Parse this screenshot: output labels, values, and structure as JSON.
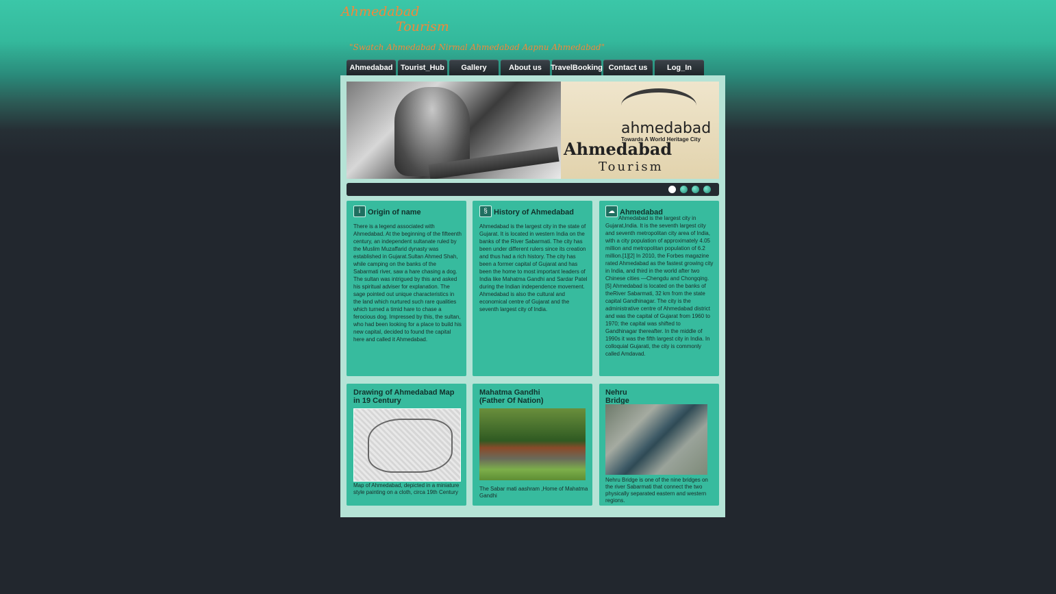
{
  "header": {
    "logo_line1": "Ahmedabad",
    "logo_line2": "Tourism",
    "tagline": "\"Swatch Ahmedabad Nirmal Ahmedabad Aapnu Ahmedabad\""
  },
  "nav": {
    "items": [
      "Ahmedabad",
      "Tourist_Hub",
      "Gallery",
      "About us",
      "TravelBooking",
      "Contact us",
      "Log_In"
    ]
  },
  "banner": {
    "poster_title": "ahmedabad",
    "poster_subtitle": "Towards A World Heritage City",
    "poster_big": "Ahmedabad",
    "poster_tourism": "Tourism"
  },
  "slider": {
    "slide_count": 4,
    "active_index": 0
  },
  "cards_top": [
    {
      "title": "Origin of name",
      "icon": "info-icon",
      "text": "There is a legend associated with Ahmedabad. At the beginning of the fifteenth century, an independent sultanate ruled by the Muslim Muzaffarid dynasty was established in Gujarat.Sultan Ahmed Shah, while camping on the banks of the Sabarmati river, saw a hare chasing a dog. The sultan was intrigued by this and asked his spiritual adviser for explanation. The sage pointed out unique characteristics in the land which nurtured such rare qualities which turned a timid hare to chase a ferocious dog. Impressed by this, the sultan, who had been looking for a place to build his new capital, decided to found the capital here and called it Ahmedabad."
    },
    {
      "title": "History of Ahmedabad",
      "icon": "scroll-icon",
      "text": "Ahmedabad is the largest city in the state of Gujarat. It is located in western India on the banks of the River Sabarmati. The city has been under different rulers since its creation and thus had a rich history. The city has been a former capital of Gujarat and has been the home to most important leaders of India like Mahatma Gandhi and Sardar Patel during the Indian independence movement. Ahmedabad is also the cultural and economical centre of Gujarat and the seventh largest city of India."
    },
    {
      "title": "Ahmedabad",
      "icon": "chat-icon",
      "text": "Ahmedabad is the largest city in Gujarat,India. It is the seventh largest city and seventh metropolitan city area of India, with a city population of approximately 4.05 million and metropolitan population of 6.2 million.[1][2] In 2010, the Forbes magazine rated Ahmedabad as the fastest growing city in India, and third in the world after two Chinese cities —Chengdu and Chongqing.[5] Ahmedabad is located on the banks of theRiver Sabarmati, 32 km from the state capital Gandhinagar. The city is the administrative centre of Ahmedabad district and was the capital of Gujarat from 1960 to 1970; the capital was shifted to Gandhinagar thereafter. In the middle of 1990s it was the fifth largest city in India. In colloquial Gujarati, the city is commonly called Amdavad."
    }
  ],
  "cards_bottom": [
    {
      "title": "Drawing of Ahmedabad Map in 19 Century",
      "caption": "Map of Ahmedabad, depicted in a miniature style painting on a cloth, circa 19th Century"
    },
    {
      "title_line1": "Mahatma Gandhi",
      "title_line2": "(Father Of Nation)",
      "caption": "The Sabar mati aashram ,Home of Mahatma Gandhi"
    },
    {
      "title_line1": "Nehru",
      "title_line2": "Bridge",
      "caption": "Nehru Bridge is one of the nine bridges on the river Sabarmati that connect the two physically separated eastern and western regions."
    }
  ],
  "colors": {
    "accent": "#37bb9e",
    "container": "#b5e3d6",
    "logo": "#f2883a",
    "nav": "#1e2428"
  }
}
